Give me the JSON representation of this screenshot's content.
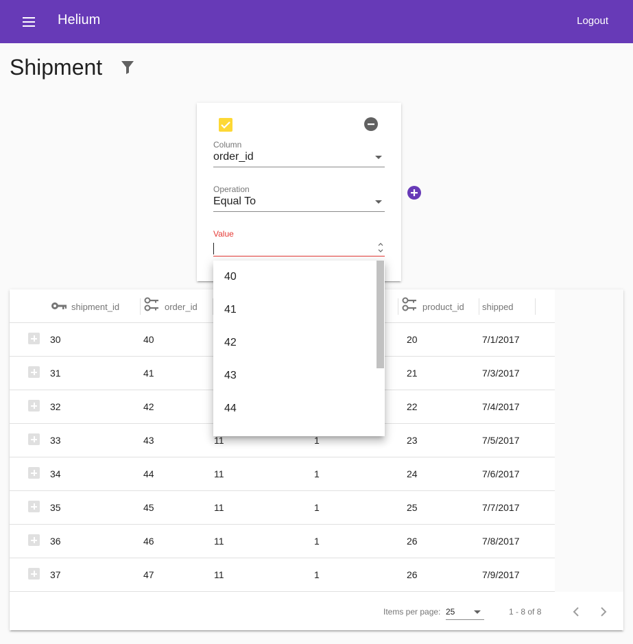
{
  "app": {
    "title": "Helium",
    "logout_label": "Logout"
  },
  "page": {
    "title": "Shipment"
  },
  "filter": {
    "column_label": "Column",
    "column_value": "order_id",
    "operation_label": "Operation",
    "operation_value": "Equal To",
    "value_label": "Value",
    "value_input": ""
  },
  "dropdown_options": [
    "40",
    "41",
    "42",
    "43",
    "44"
  ],
  "table": {
    "columns": [
      "shipment_id",
      "order_id",
      "",
      "",
      "product_id",
      "shipped"
    ],
    "rows": [
      [
        "30",
        "40",
        "",
        "",
        "20",
        "7/1/2017"
      ],
      [
        "31",
        "41",
        "",
        "",
        "21",
        "7/3/2017"
      ],
      [
        "32",
        "42",
        "",
        "",
        "22",
        "7/4/2017"
      ],
      [
        "33",
        "43",
        "11",
        "1",
        "23",
        "7/5/2017"
      ],
      [
        "34",
        "44",
        "11",
        "1",
        "24",
        "7/6/2017"
      ],
      [
        "35",
        "45",
        "11",
        "1",
        "25",
        "7/7/2017"
      ],
      [
        "36",
        "46",
        "11",
        "1",
        "26",
        "7/8/2017"
      ],
      [
        "37",
        "47",
        "11",
        "1",
        "26",
        "7/9/2017"
      ]
    ]
  },
  "paginator": {
    "items_per_page_label": "Items per page:",
    "page_size": "25",
    "range_label": "1 - 8 of 8"
  },
  "colors": {
    "primary": "#673ab7",
    "accent": "#fdd835",
    "warn": "#e53935"
  }
}
